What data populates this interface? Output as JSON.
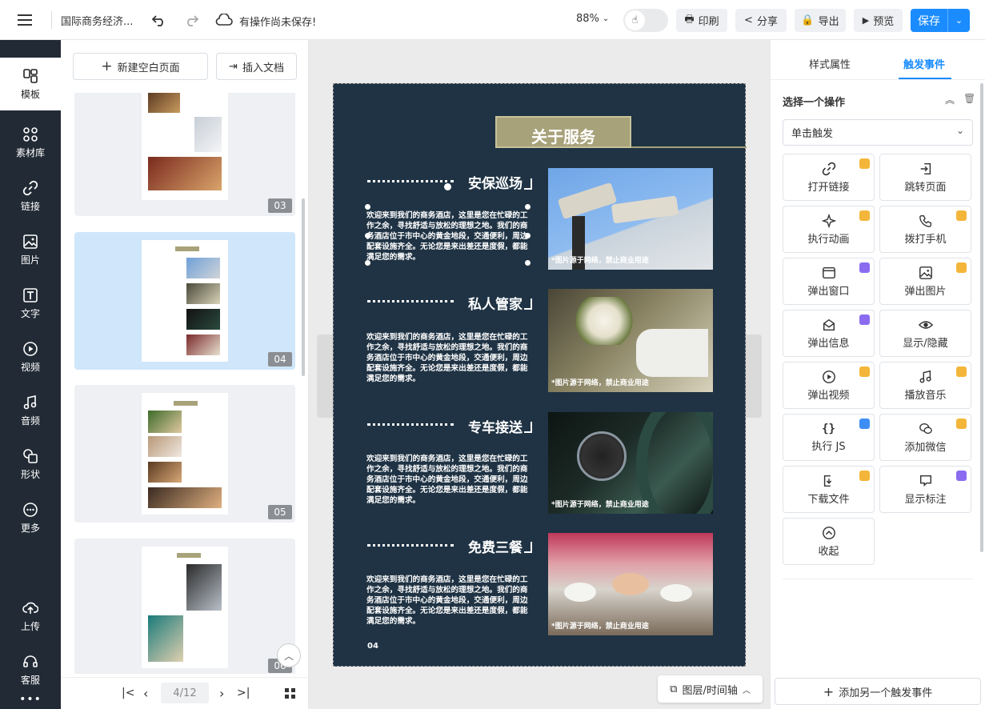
{
  "topbar": {
    "title": "国际商务经济...",
    "save_status": "有操作尚未保存!",
    "zoom": "88%",
    "print": "印刷",
    "share": "分享",
    "export": "导出",
    "preview": "预览",
    "save": "保存"
  },
  "leftnav": [
    {
      "label": "模板"
    },
    {
      "label": "素材库"
    },
    {
      "label": "链接"
    },
    {
      "label": "图片"
    },
    {
      "label": "文字"
    },
    {
      "label": "视频"
    },
    {
      "label": "音频"
    },
    {
      "label": "形状"
    },
    {
      "label": "更多"
    },
    {
      "label": "上传"
    },
    {
      "label": "客服"
    }
  ],
  "pages_panel": {
    "new_page": "新建空白页面",
    "insert_doc": "插入文档",
    "pages": [
      {
        "num": "03"
      },
      {
        "num": "04"
      },
      {
        "num": "05"
      },
      {
        "num": "06"
      }
    ],
    "pager": "4/12"
  },
  "canvas": {
    "title": "关于服务",
    "page_no": "04",
    "sections": [
      {
        "heading": "安保巡场",
        "body": "欢迎来到我们的商务酒店，这里是您在忙碌的工作之余，寻找舒适与放松的理想之地。我们的商务酒店位于市中心的黄金地段，交通便利，周边配套设施齐全。无论您是来出差还是度假，都能满足您的需求。",
        "caption": "*图片源于网络，禁止商业用途"
      },
      {
        "heading": "私人管家",
        "body": "欢迎来到我们的商务酒店，这里是您在忙碌的工作之余，寻找舒适与放松的理想之地。我们的商务酒店位于市中心的黄金地段，交通便利，周边配套设施齐全。无论您是来出差还是度假，都能满足您的需求。",
        "caption": "*图片源于网络，禁止商业用途"
      },
      {
        "heading": "专车接送",
        "body": "欢迎来到我们的商务酒店，这里是您在忙碌的工作之余，寻找舒适与放松的理想之地。我们的商务酒店位于市中心的黄金地段，交通便利，周边配套设施齐全。无论您是来出差还是度假，都能满足您的需求。",
        "caption": "*图片源于网络，禁止商业用途"
      },
      {
        "heading": "免费三餐",
        "body": "欢迎来到我们的商务酒店，这里是您在忙碌的工作之余，寻找舒适与放松的理想之地。我们的商务酒店位于市中心的黄金地段，交通便利，周边配套设施齐全。无论您是来出差还是度假，都能满足您的需求。",
        "caption": "*图片源于网络，禁止商业用途"
      }
    ],
    "layers_btn": "图层/时间轴"
  },
  "rpanel": {
    "tab_style": "样式属性",
    "tab_trigger": "触发事件",
    "choose_op": "选择一个操作",
    "trigger_select": "单击触发",
    "add_event": "添加另一个触发事件",
    "actions": [
      {
        "label": "打开链接"
      },
      {
        "label": "跳转页面"
      },
      {
        "label": "执行动画"
      },
      {
        "label": "拨打手机"
      },
      {
        "label": "弹出窗口"
      },
      {
        "label": "弹出图片"
      },
      {
        "label": "弹出信息"
      },
      {
        "label": "显示/隐藏"
      },
      {
        "label": "弹出视频"
      },
      {
        "label": "播放音乐"
      },
      {
        "label": "执行 JS"
      },
      {
        "label": "添加微信"
      },
      {
        "label": "下载文件"
      },
      {
        "label": "显示标注"
      },
      {
        "label": "收起"
      }
    ]
  },
  "colors": {
    "accent": "#1a8cff",
    "page_bg": "#1f3344",
    "gold": "#a8a27a"
  }
}
